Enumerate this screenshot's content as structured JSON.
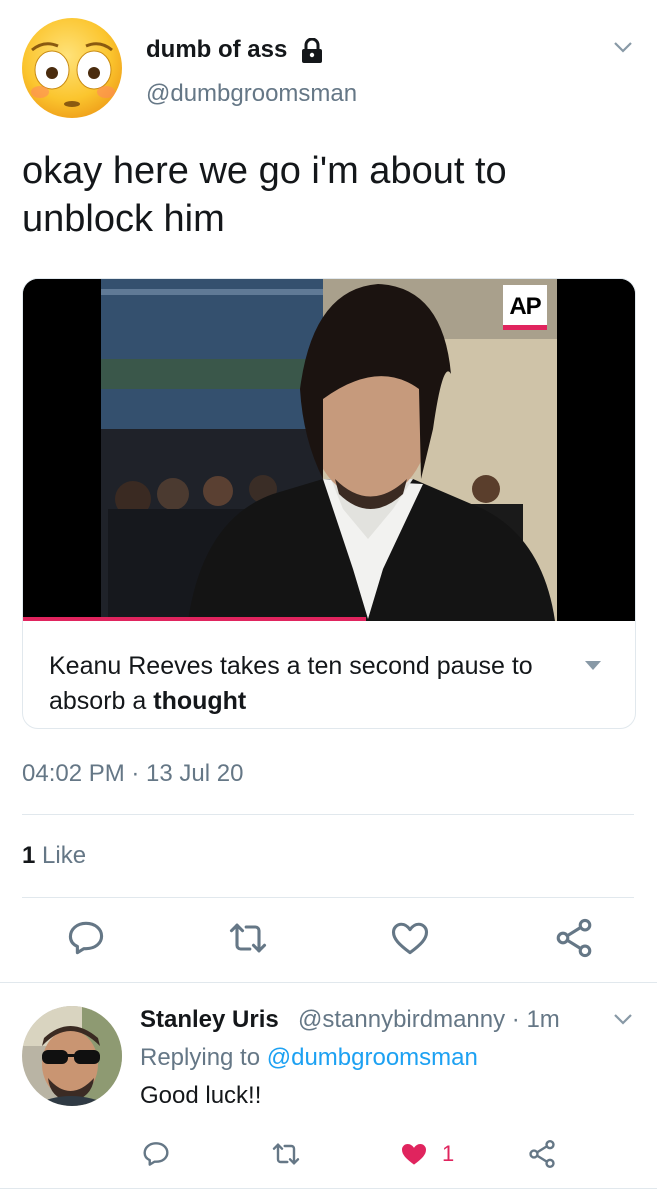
{
  "tweet": {
    "display_name": "dumb of ass",
    "handle": "@dumbgroomsman",
    "text": "okay here we go i'm about to unblock him",
    "media": {
      "source_logo": "AP",
      "caption_prefix": "Keanu Reeves takes a ten second pause to absorb a",
      "caption_bold": "thought",
      "progress": 0.56
    },
    "timestamp": "04:02 PM · 13 Jul 20",
    "likes_count": "1",
    "likes_label": "Like",
    "actions": [
      "reply-icon",
      "retweet-icon",
      "like-icon",
      "share-icon"
    ]
  },
  "reply": {
    "display_name": "Stanley Uris",
    "handle_time": "@stannybirdmanny · 1m",
    "replying_prefix": "Replying to",
    "replying_mention": "@dumbgroomsman",
    "text": "Good luck!!",
    "like_count": "1",
    "liked": true
  },
  "colors": {
    "text": "#14171a",
    "secondary": "#657786",
    "link": "#1da1f2",
    "like": "#e0245e",
    "divider": "#e1e8ed"
  }
}
